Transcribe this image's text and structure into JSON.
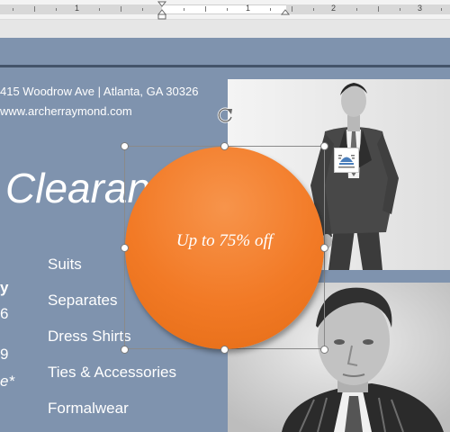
{
  "ruler": {
    "numbers": [
      "1",
      "1",
      "2",
      "3"
    ]
  },
  "header": {
    "address": "415 Woodrow Ave | Atlanta, GA 30326",
    "website": "www.archerraymond.com"
  },
  "headline": "Clearan",
  "left_fragments": {
    "y": "y",
    "six": "6",
    "nine": "9",
    "e": "e*"
  },
  "categories": [
    "Suits",
    "Separates",
    "Dress Shirts",
    "Ties & Accessories",
    "Formalwear"
  ],
  "promo": {
    "text": "Up to 75% off",
    "color": "#f27a26"
  },
  "selection": {
    "icons": [
      "rotate-handle-icon",
      "layout-options-icon"
    ]
  },
  "colors": {
    "page_bg": "#7f93ae",
    "rule": "#44546a",
    "circle": "#f27a26"
  }
}
